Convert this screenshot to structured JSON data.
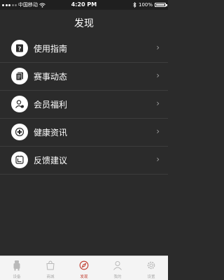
{
  "status_bar": {
    "carrier": "中国移动",
    "time": "4:20 PM",
    "battery": "100%"
  },
  "nav": {
    "title": "发现"
  },
  "menu": {
    "items": [
      {
        "label": "使用指南",
        "icon": "guide-icon"
      },
      {
        "label": "赛事动态",
        "icon": "document-icon"
      },
      {
        "label": "会员福利",
        "icon": "member-icon"
      },
      {
        "label": "健康资讯",
        "icon": "health-icon"
      },
      {
        "label": "反馈建议",
        "icon": "feedback-icon"
      }
    ],
    "chevron": "›"
  },
  "tabbar": {
    "tabs": [
      {
        "label": "设备",
        "icon": "device-icon"
      },
      {
        "label": "商城",
        "icon": "shop-icon"
      },
      {
        "label": "发现",
        "icon": "discover-icon",
        "active": true
      },
      {
        "label": "我的",
        "icon": "profile-icon"
      },
      {
        "label": "设置",
        "icon": "settings-icon"
      }
    ]
  },
  "colors": {
    "background": "#2b2b2b",
    "active_tab": "#c0392b"
  }
}
